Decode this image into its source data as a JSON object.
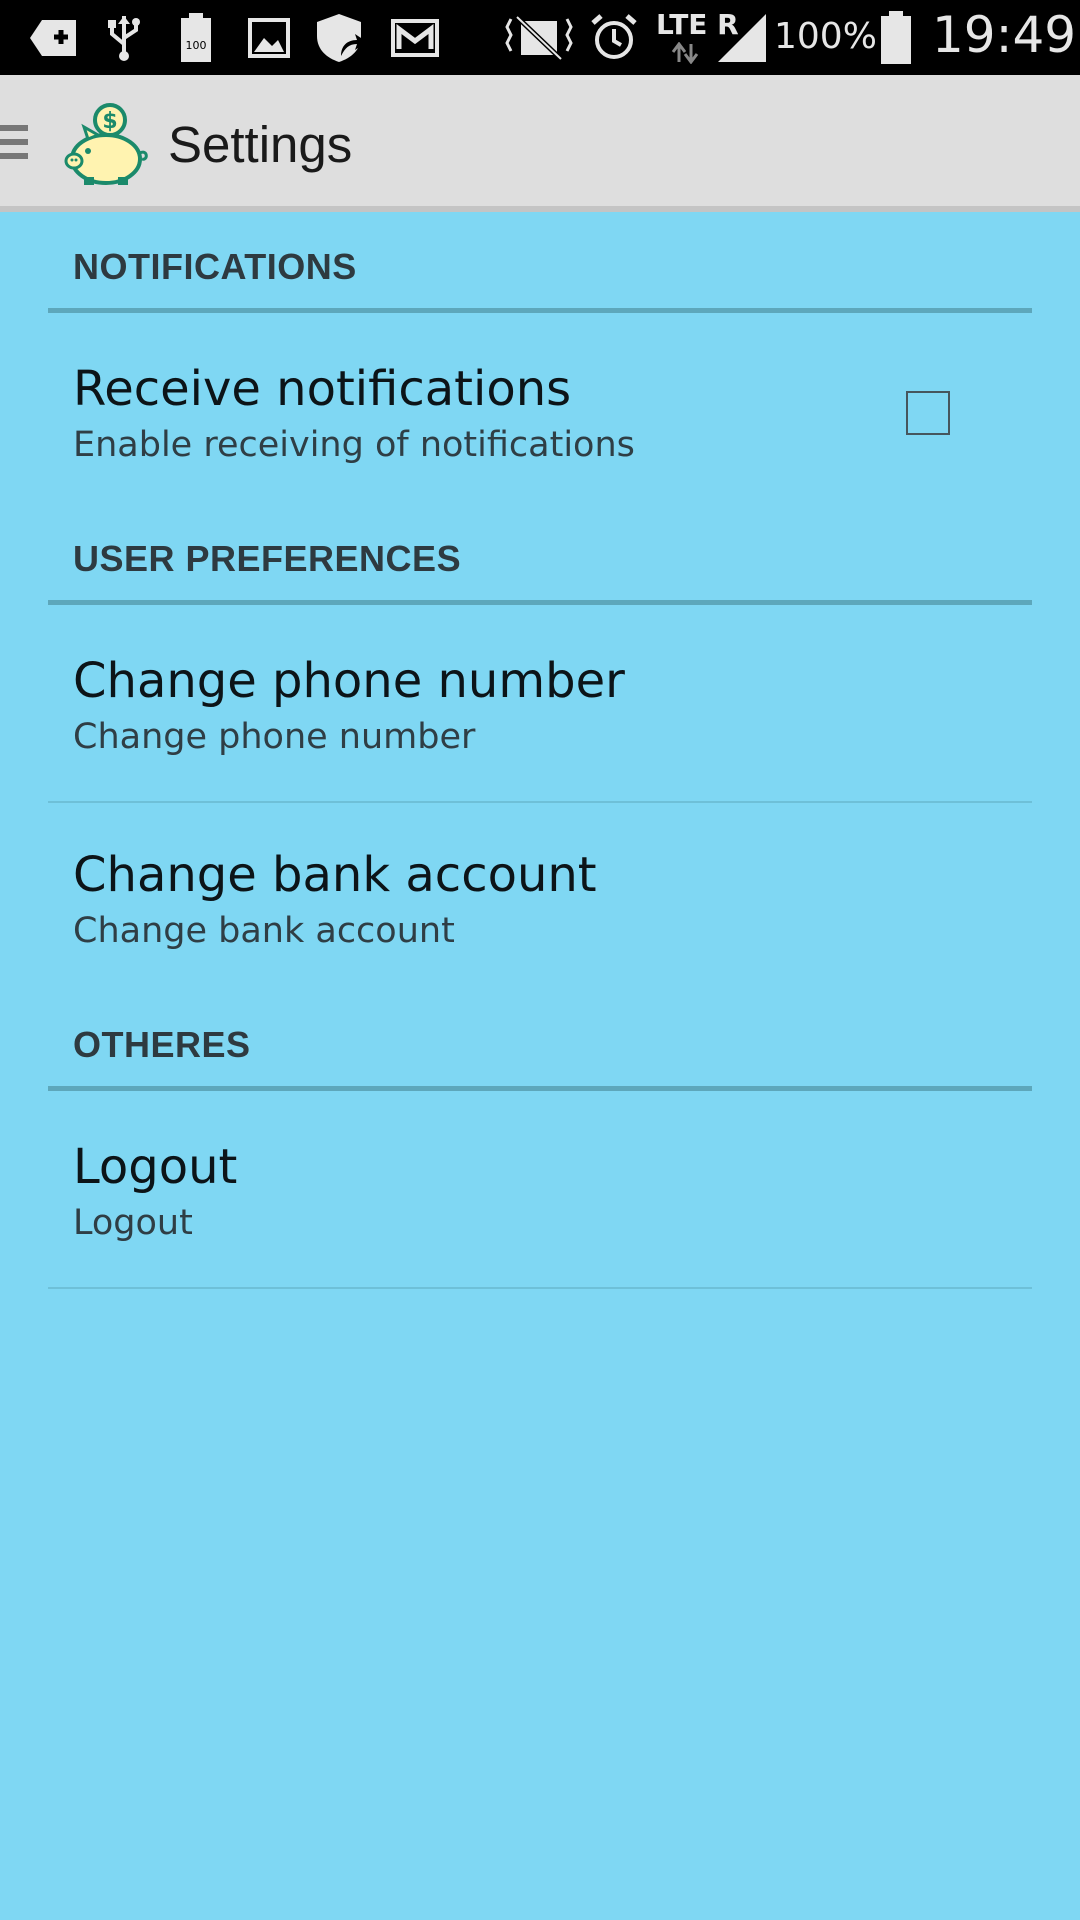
{
  "status_bar": {
    "battery_percent": "100%",
    "network": "LTE R",
    "time": "19:49",
    "battery_icon_text": "100",
    "icons": [
      "add-icon",
      "usb-icon",
      "battery-saver-icon",
      "image-icon",
      "shield-icon",
      "gmail-icon",
      "vibrate-icon",
      "alarm-icon",
      "signal-icon",
      "battery-icon"
    ]
  },
  "action_bar": {
    "title": "Settings",
    "logo": "piggy-bank-logo",
    "drawer_icon": "drawer-menu-icon"
  },
  "sections": {
    "notifications": {
      "header": "NOTIFICATIONS",
      "items": [
        {
          "title": "Receive notifications",
          "summary": "Enable receiving of notifications",
          "checked": false
        }
      ]
    },
    "user_preferences": {
      "header": "USER PREFERENCES",
      "items": [
        {
          "title": "Change phone number",
          "summary": "Change phone number"
        },
        {
          "title": "Change bank account",
          "summary": "Change bank account"
        }
      ]
    },
    "others": {
      "header": "OTHERES",
      "items": [
        {
          "title": "Logout",
          "summary": "Logout"
        }
      ]
    }
  },
  "colors": {
    "background": "#7fd7f3",
    "action_bar": "#dedede",
    "section_divider": "#5da7bb",
    "logo_green": "#1b8a6b",
    "logo_yellow": "#fff3b0"
  }
}
